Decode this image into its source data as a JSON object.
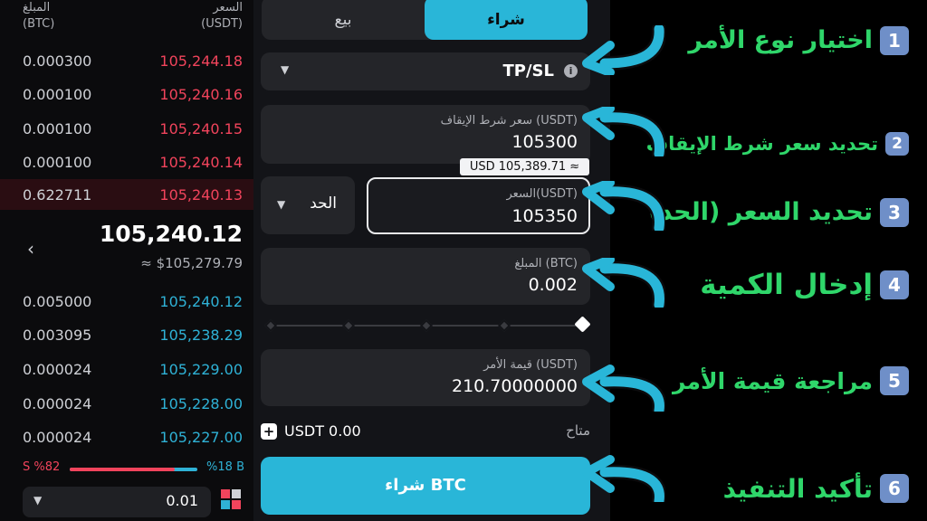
{
  "orderbook": {
    "header": {
      "left": "المبلغ\n(BTC)",
      "right": "السعر\n(USDT)"
    },
    "asks": [
      {
        "amount": "0.000300",
        "price": "105,244.18"
      },
      {
        "amount": "0.000100",
        "price": "105,240.16"
      },
      {
        "amount": "0.000100",
        "price": "105,240.15"
      },
      {
        "amount": "0.000100",
        "price": "105,240.14"
      },
      {
        "amount": "0.622711",
        "price": "105,240.13"
      }
    ],
    "mid_price": "105,240.12",
    "mid_usd": "≈ $105,279.79",
    "bids": [
      {
        "amount": "0.005000",
        "price": "105,240.12"
      },
      {
        "amount": "0.003095",
        "price": "105,238.29"
      },
      {
        "amount": "0.000024",
        "price": "105,229.00"
      },
      {
        "amount": "0.000024",
        "price": "105,228.00"
      },
      {
        "amount": "0.000024",
        "price": "105,227.00"
      }
    ],
    "sell_ratio": "S %82",
    "buy_ratio": "%18 B",
    "sell_fraction": 0.82,
    "precision": "0.01"
  },
  "form": {
    "tab_sell": "بيع",
    "tab_buy": "شراء",
    "order_type": "TP/SL",
    "trigger_label": "سعر شرط الإيقاف (USDT)",
    "trigger_value": "105300",
    "trigger_estimate": "USD 105,389.71 ≈",
    "price_type": "الحد",
    "price_label": "السعر(USDT)",
    "price_value": "105350",
    "amount_label": "المبلغ (BTC)",
    "amount_value": "0.002",
    "order_value_label": "قيمة الأمر (USDT)",
    "order_value": "210.70000000",
    "available_label": "متاح",
    "available_value": "USDT 0.00",
    "buy_button": "شراء BTC"
  },
  "steps": [
    {
      "num": "1",
      "text": "اختيار نوع الأمر"
    },
    {
      "num": "2",
      "text": "تحديد سعر شرط الإيقاف"
    },
    {
      "num": "3",
      "text": "تحديد السعر (الحد)"
    },
    {
      "num": "4",
      "text": "إدخال الكمية"
    },
    {
      "num": "5",
      "text": "مراجعة قيمة الأمر"
    },
    {
      "num": "6",
      "text": "تأكيد التنفيذ"
    }
  ],
  "colors": {
    "buy_accent": "#29b6d8",
    "sell_red": "#f2445c",
    "step_green": "#2fd66a",
    "arrow_blue": "#29b6d8"
  }
}
